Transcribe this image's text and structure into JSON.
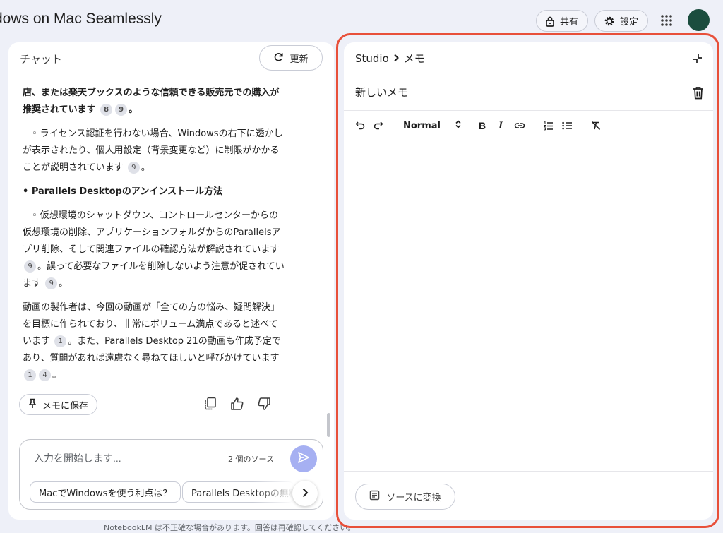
{
  "header": {
    "title": "dows on Mac Seamlessly",
    "share_label": "共有",
    "settings_label": "設定"
  },
  "chat": {
    "title": "チャット",
    "refresh_label": "更新",
    "paragraphs": [
      {
        "text": "店、または楽天ブックスのような信頼できる販売元での購入が推奨されています",
        "cites": [
          "8",
          "9"
        ],
        "tail": "。"
      },
      {
        "text": "　◦ ライセンス認証を行わない場合、Windowsの右下に透かしが表示されたり、個人用設定（背景変更など）に制限がかかることが説明されています",
        "cites": [
          "9"
        ],
        "tail": "。"
      },
      {
        "text": "• Parallels Desktopのアンインストール方法"
      },
      {
        "text_a": "　◦ 仮想環境のシャットダウン、コントロールセンターからの仮想環境の削除、アプリケーションフォルダからのParallelsアプリ削除、そして関連ファイルの確認方法が解説されています",
        "cite_a": "9",
        "text_b": "。誤って必要なファイルを削除しないよう注意が促されています",
        "cite_b": "9",
        "tail": "。"
      },
      {
        "text_a": "動画の製作者は、今回の動画が「全ての方の悩み、疑問解決」を目標に作られており、非常にボリューム満点であると述べています",
        "cite_a": "1",
        "text_b": "。また、Parallels Desktop 21の動画も作成予定であり、質問があれば遠慮なく尋ねてほしいと呼びかけています",
        "cites_b": [
          "1",
          "4"
        ],
        "tail": "。"
      }
    ],
    "save_memo_label": "メモに保存",
    "input_placeholder": "入力を開始します...",
    "source_count": "2 個のソース",
    "suggestions": [
      "MacでWindowsを使う利点は？",
      "Parallels Desktopの無料"
    ],
    "footer_note": "NotebookLM は不正確な場合があります。回答は再確認してください。"
  },
  "studio": {
    "crumb_root": "Studio",
    "crumb_current": "メモ",
    "memo_title": "新しいメモ",
    "format_label": "Normal",
    "convert_label": "ソースに変換"
  },
  "colors": {
    "background": "#eef0f8",
    "highlight": "#e8503a",
    "avatar": "#1b4d3e",
    "send_button": "#a6b0f2"
  }
}
